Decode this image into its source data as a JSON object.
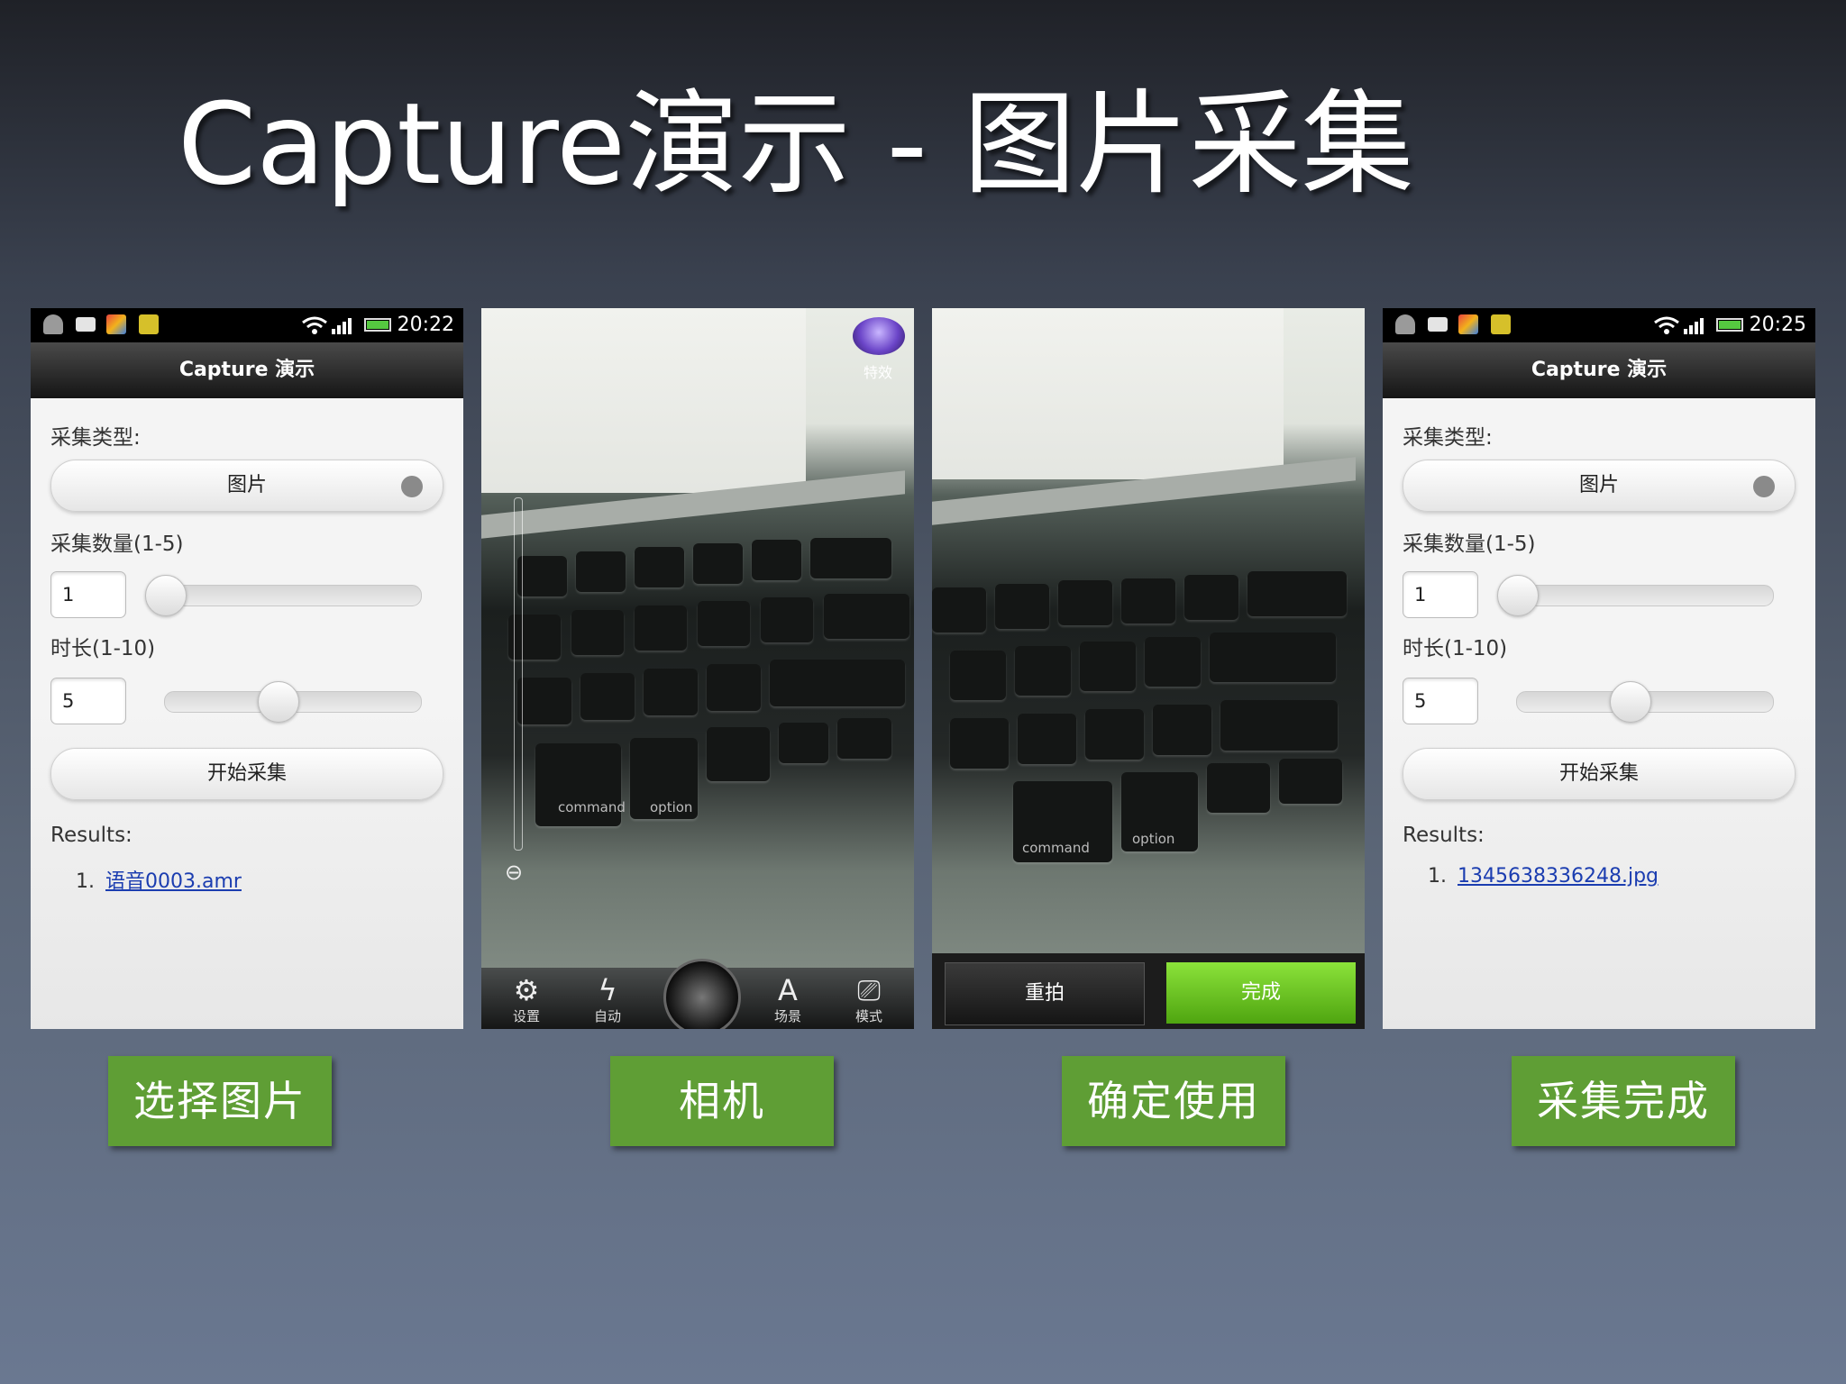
{
  "slide": {
    "title": "Capture演示 - 图片采集"
  },
  "colors": {
    "caption_bg": "#5f9e35",
    "link": "#1b3db0",
    "done_btn": "#6cc423"
  },
  "screens": [
    {
      "time": "20:22",
      "app_title": "Capture 演示",
      "type_label": "采集类型:",
      "type_value": "图片",
      "count_label": "采集数量(1-5)",
      "count_value": "1",
      "count_slider": 0.0,
      "duration_label": "时长(1-10)",
      "duration_value": "5",
      "duration_slider": 0.44,
      "start_button": "开始采集",
      "results_label": "Results:",
      "result_index": "1.",
      "result_item": "语音0003.amr"
    },
    {
      "effects_label": "特效",
      "toolbar": [
        {
          "icon": "gear-icon",
          "label": "设置"
        },
        {
          "icon": "flash-auto-icon",
          "label": "自动"
        },
        {
          "icon": "scene-icon",
          "label": "场景"
        },
        {
          "icon": "camera-mode-icon",
          "label": "模式"
        }
      ]
    },
    {
      "retake_label": "重拍",
      "done_label": "完成"
    },
    {
      "time": "20:25",
      "app_title": "Capture 演示",
      "type_label": "采集类型:",
      "type_value": "图片",
      "count_label": "采集数量(1-5)",
      "count_value": "1",
      "count_slider": 0.0,
      "duration_label": "时长(1-10)",
      "duration_value": "5",
      "duration_slider": 0.44,
      "start_button": "开始采集",
      "results_label": "Results:",
      "result_index": "1.",
      "result_item": "1345638336248.jpg"
    }
  ],
  "captions": [
    "选择图片",
    "相机",
    "确定使用",
    "采集完成"
  ]
}
